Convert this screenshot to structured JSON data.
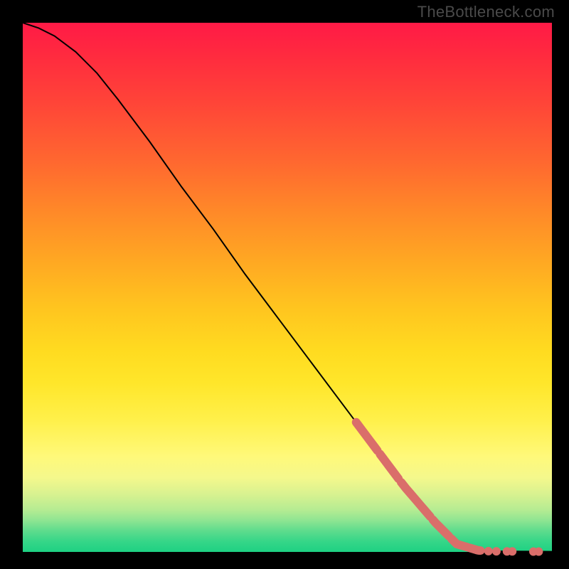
{
  "watermark": "TheBottleneck.com",
  "chart_data": {
    "type": "line",
    "title": "",
    "xlabel": "",
    "ylabel": "",
    "xlim": [
      0,
      100
    ],
    "ylim": [
      0,
      100
    ],
    "curve": {
      "x": [
        0,
        3,
        6,
        10,
        14,
        18,
        24,
        30,
        36,
        42,
        48,
        54,
        60,
        66,
        72,
        78,
        82,
        86,
        88,
        92,
        96,
        100
      ],
      "y": [
        100,
        99,
        97.5,
        94.5,
        90.5,
        85.5,
        77.5,
        69,
        61,
        52.5,
        44.5,
        36.5,
        28.5,
        20.5,
        12.5,
        5.5,
        1.5,
        0.3,
        0.15,
        0.1,
        0.08,
        0.05
      ]
    },
    "highlight_segments": [
      {
        "x0": 63,
        "x1": 67
      },
      {
        "x0": 67.5,
        "x1": 71
      },
      {
        "x0": 71.5,
        "x1": 77
      },
      {
        "x0": 77.5,
        "x1": 80.5
      },
      {
        "x0": 81,
        "x1": 84
      },
      {
        "x0": 84.5,
        "x1": 86.5
      }
    ],
    "highlight_dots": [
      {
        "x": 88,
        "y": 0.15
      },
      {
        "x": 89.5,
        "y": 0.12
      },
      {
        "x": 91.5,
        "y": 0.1
      },
      {
        "x": 92.5,
        "y": 0.1
      },
      {
        "x": 96.5,
        "y": 0.07
      },
      {
        "x": 97.5,
        "y": 0.06
      }
    ],
    "highlight_color": "#da6e6a",
    "highlight_stroke_width": 12,
    "highlight_dot_radius": 6
  }
}
